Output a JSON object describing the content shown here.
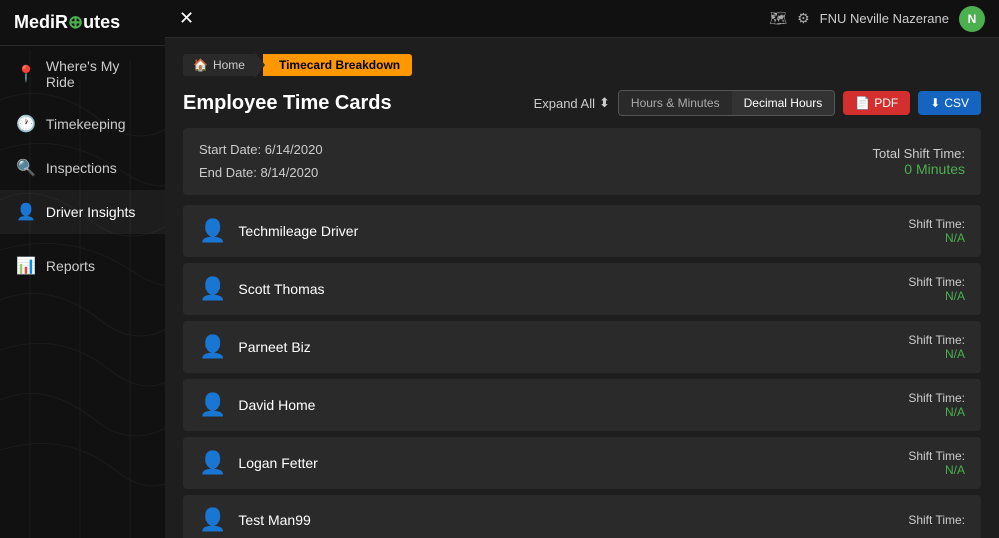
{
  "logo": {
    "text": "MediR",
    "highlight": "outes",
    "dot": "●"
  },
  "topbar": {
    "close_icon": "✕",
    "settings_icon": "⚙",
    "user_name": "FNU Neville Nazerane",
    "avatar_initials": "N"
  },
  "nav": {
    "items": [
      {
        "id": "wheres-my-ride",
        "label": "Where's My Ride",
        "icon": "📍"
      },
      {
        "id": "timekeeping",
        "label": "Timekeeping",
        "icon": "🕐"
      },
      {
        "id": "inspections",
        "label": "Inspections",
        "icon": "🔍"
      },
      {
        "id": "driver-insights",
        "label": "Driver Insights",
        "icon": "👤"
      },
      {
        "id": "reports",
        "label": "Reports",
        "icon": "📊"
      }
    ]
  },
  "breadcrumb": {
    "home_label": "Home",
    "current_label": "Timecard Breakdown"
  },
  "page": {
    "title": "Employee Time Cards",
    "expand_all": "Expand All",
    "toggle": {
      "option1": "Hours & Minutes",
      "option2": "Decimal Hours",
      "active": "option2"
    },
    "pdf_label": "PDF",
    "csv_label": "CSV"
  },
  "date_info": {
    "start_label": "Start Date:",
    "start_value": "6/14/2020",
    "end_label": "End Date:",
    "end_value": "8/14/2020",
    "total_shift_label": "Total Shift Time:",
    "total_shift_value": "0 Minutes"
  },
  "employees": [
    {
      "name": "Techmileage Driver",
      "shift_label": "Shift Time:",
      "shift_value": "N/A"
    },
    {
      "name": "Scott Thomas",
      "shift_label": "Shift Time:",
      "shift_value": "N/A"
    },
    {
      "name": "Parneet Biz",
      "shift_label": "Shift Time:",
      "shift_value": "N/A"
    },
    {
      "name": "David Home",
      "shift_label": "Shift Time:",
      "shift_value": "N/A"
    },
    {
      "name": "Logan Fetter",
      "shift_label": "Shift Time:",
      "shift_value": "N/A"
    },
    {
      "name": "Test Man99",
      "shift_label": "Shift Time:",
      "shift_value": ""
    }
  ]
}
